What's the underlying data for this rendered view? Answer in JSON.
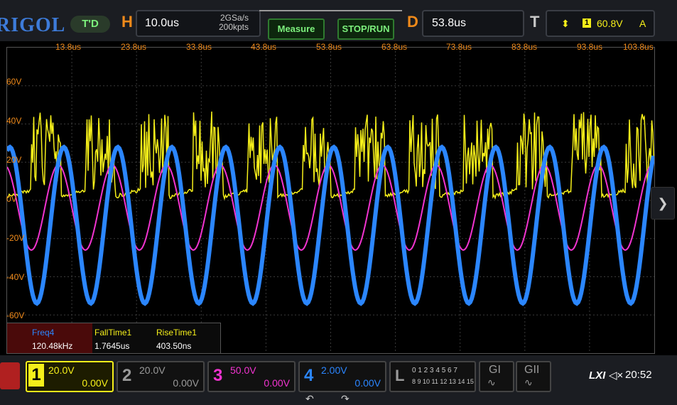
{
  "header": {
    "logo": "RIGOL",
    "run_status": "T'D",
    "horizontal": {
      "letter": "H",
      "timebase": "10.0us",
      "sample_rate": "2GSa/s",
      "points": "200kpts"
    },
    "measure_label": "Measure",
    "stop_run_label": "STOP/RUN",
    "delay": {
      "letter": "D",
      "value": "53.8us"
    },
    "trigger": {
      "letter": "T",
      "level": "60.8V",
      "mode": "A",
      "channel": "1"
    }
  },
  "grid": {
    "time_labels": [
      "13.8us",
      "23.8us",
      "33.8us",
      "43.8us",
      "53.8us",
      "63.8us",
      "73.8us",
      "83.8us",
      "93.8us",
      "103.8us"
    ],
    "volt_labels": [
      "60V",
      "40V",
      "20V",
      "0V",
      "-20V",
      "-40V",
      "-60V"
    ]
  },
  "measurements": {
    "items": [
      {
        "name": "Freq4",
        "value": "120.48kHz"
      },
      {
        "name": "FallTime1",
        "value": "1.7645us"
      },
      {
        "name": "RiseTime1",
        "value": "403.50ns"
      }
    ]
  },
  "channels": [
    {
      "num": "1",
      "scale": "20.0V",
      "offset": "0.00V",
      "color": "#f5ef1a"
    },
    {
      "num": "2",
      "scale": "20.0V",
      "offset": "0.00V",
      "color": "#9a9a9a"
    },
    {
      "num": "3",
      "scale": "50.0V",
      "offset": "0.00V",
      "color": "#f233d0"
    },
    {
      "num": "4",
      "scale": "2.00V",
      "offset": "0.00V",
      "color": "#2b86ff"
    }
  ],
  "digital": {
    "letter": "L",
    "row1": "0 1 2 3  4 5 6 7",
    "row2": "8 9 10 11  12 13 14 15"
  },
  "gi_label": "GI",
  "gii_label": "GII",
  "lxi_label": "LXI",
  "clock": "20:52",
  "colors": {
    "grid_accent": "#f08a1a",
    "ch1": "#f5ef1a",
    "ch3": "#f233d0",
    "ch4": "#2b86ff"
  }
}
